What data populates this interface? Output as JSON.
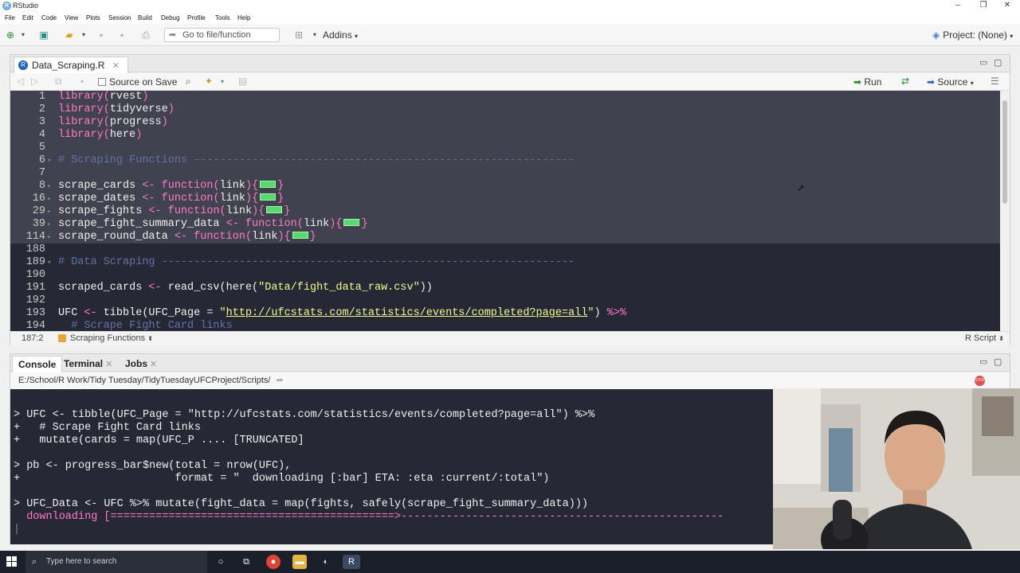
{
  "window": {
    "title": "RStudio"
  },
  "menu": [
    "File",
    "Edit",
    "Code",
    "View",
    "Plots",
    "Session",
    "Build",
    "Debug",
    "Profile",
    "Tools",
    "Help"
  ],
  "toolbar": {
    "goto_placeholder": "Go to file/function",
    "addins_label": "Addins",
    "project_label": "Project: (None)"
  },
  "editor": {
    "tab_label": "Data_Scraping.R",
    "source_on_save": "Source on Save",
    "run_label": "Run",
    "source_label": "Source",
    "status_pos": "187:2",
    "status_section": "Scraping Functions",
    "file_type": "R Script",
    "lines": [
      {
        "n": "1",
        "code": "library(rvest)"
      },
      {
        "n": "2",
        "code": "library(tidyverse)"
      },
      {
        "n": "3",
        "code": "library(progress)"
      },
      {
        "n": "4",
        "code": "library(here)"
      },
      {
        "n": "5",
        "code": ""
      },
      {
        "n": "6",
        "code": "# Scraping Functions -----------------------------------------------------------"
      },
      {
        "n": "7",
        "code": ""
      },
      {
        "n": "8",
        "code": "scrape_cards <- function(link){"
      },
      {
        "n": "16",
        "code": "scrape_dates <- function(link){"
      },
      {
        "n": "29",
        "code": "scrape_fights <- function(link){"
      },
      {
        "n": "39",
        "code": "scrape_fight_summary_data <- function(link){"
      },
      {
        "n": "114",
        "code": "scrape_round_data <- function(link){"
      },
      {
        "n": "188",
        "code": ""
      },
      {
        "n": "189",
        "code": "# Data Scraping ----------------------------------------------------------------"
      },
      {
        "n": "190",
        "code": ""
      },
      {
        "n": "191",
        "code": "scraped_cards <- read_csv(here(\"Data/fight_data_raw.csv\"))"
      },
      {
        "n": "192",
        "code": ""
      },
      {
        "n": "193",
        "code": "UFC <- tibble(UFC_Page = \"http://ufcstats.com/statistics/events/completed?page=all\") %>%"
      },
      {
        "n": "194",
        "code": "  # Scrape Fight Card links"
      }
    ]
  },
  "console": {
    "tabs": [
      "Console",
      "Terminal",
      "Jobs"
    ],
    "path": "E:/School/R Work/Tidy Tuesday/TidyTuesdayUFCProject/Scripts/",
    "stop_label": "STOP",
    "lines": [
      "> UFC <- tibble(UFC_Page = \"http://ufcstats.com/statistics/events/completed?page=all\") %>%",
      "+   # Scrape Fight Card links",
      "+   mutate(cards = map(UFC_P .... [TRUNCATED]",
      "",
      "> pb <- progress_bar$new(total = nrow(UFC),",
      "+                        format = \"  downloading [:bar] ETA: :eta :current/:total\")",
      "",
      "> UFC_Data <- UFC %>% mutate(fight_data = map(fights, safely(scrape_fight_summary_data)))",
      "  downloading [============================================>--------------------------------------------------"
    ],
    "progress": 0.45
  },
  "taskbar": {
    "search_placeholder": "Type here to search"
  },
  "colors": {
    "editor_bg": "#272835",
    "selection": "#41424f",
    "keyword": "#ff79c6",
    "string": "#f1fa8c",
    "comment": "#6272a4",
    "fold_chip": "#57d96e"
  }
}
